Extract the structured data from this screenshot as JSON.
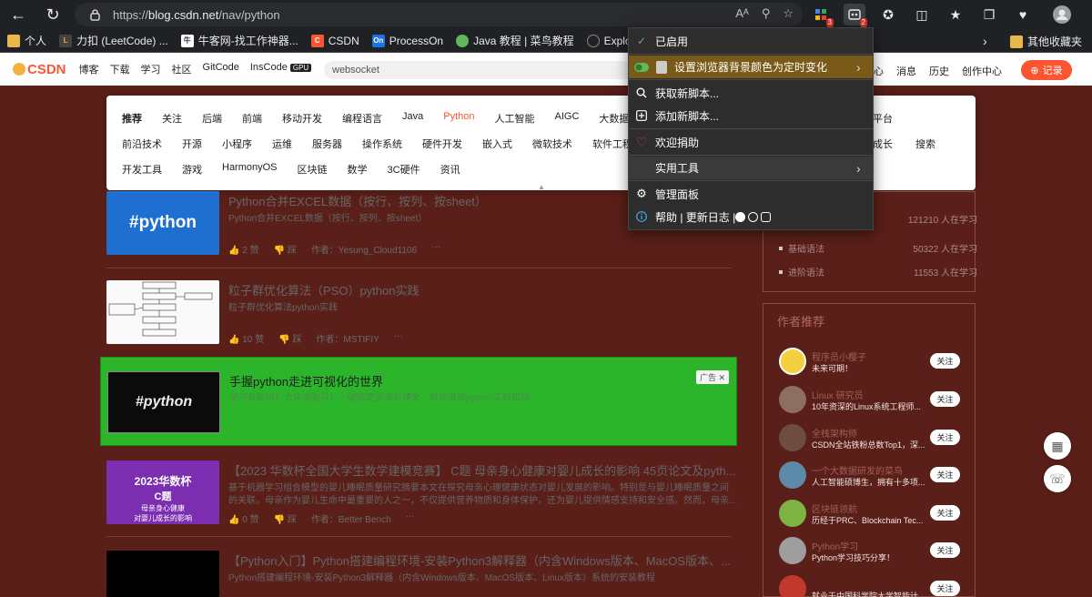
{
  "browser": {
    "url_prefix": "https://",
    "url_host": "blog.csdn.net",
    "url_path": "/nav/python",
    "reader_icon": "Aᴬ",
    "ext_badge_1": "3",
    "ext_badge_2": "2"
  },
  "bookmarks": [
    {
      "label": "个人",
      "icon": "folder-icon",
      "color": "#e8b84a"
    },
    {
      "label": "力扣 (LeetCode) ...",
      "icon": "leetcode-icon",
      "color": "#444444"
    },
    {
      "label": "牛客网-找工作神器...",
      "icon": "nowcoder-icon",
      "color": "#ffffff"
    },
    {
      "label": "CSDN",
      "icon": "csdn-icon",
      "color": "#fc5531"
    },
    {
      "label": "ProcessOn",
      "icon": "processon-icon",
      "color": "#1a73e8"
    },
    {
      "label": "Java 教程 | 菜鸟教程",
      "icon": "runoob-icon",
      "color": "#5fb85a"
    },
    {
      "label": "Explore Git",
      "icon": "github-icon",
      "color": "#222222"
    }
  ],
  "bookmarks_other": "其他收藏夹",
  "header": {
    "logo_text": "CSDN",
    "nav": [
      "博客",
      "下载",
      "学习",
      "社区",
      "GitCode",
      "InsCode"
    ],
    "gpu_badge": "GPU",
    "search_value": "websocket",
    "right_links": [
      "心",
      "消息",
      "历史",
      "创作中心"
    ],
    "record_label": "记录"
  },
  "categories": {
    "row1": [
      "推荐",
      "关注",
      "后端",
      "前端",
      "移动开发",
      "编程语言",
      "Java",
      "Python",
      "人工智能",
      "AIGC",
      "大数据"
    ],
    "row1_tail": "平台",
    "row2": [
      "前沿技术",
      "开源",
      "小程序",
      "运维",
      "服务器",
      "操作系统",
      "硬件开发",
      "嵌入式",
      "微软技术",
      "软件工程"
    ],
    "row2_tail": [
      "成长",
      "搜索"
    ],
    "row3": [
      "开发工具",
      "游戏",
      "HarmonyOS",
      "区块链",
      "数学",
      "3C硬件",
      "资讯"
    ]
  },
  "feed": [
    {
      "title": "Python合并EXCEL数据（按行、按列、按sheet）",
      "desc": "Python合并EXCEL数据（按行、按列、按sheet）",
      "likes": "2 赞",
      "comment": "踩",
      "author": "作者：Yesung_Cloud1106",
      "thumb_text": "#python"
    },
    {
      "title": "粒子群优化算法（PSO）python实践",
      "desc": "粒子群优化算法python实践",
      "likes": "10 赞",
      "comment": "踩",
      "author": "作者：MSTIFIY"
    },
    {
      "title": "【2023 华数杯全国大学生数学建模竞赛】 C题 母亲身心健康对婴儿成长的影响 45页论文及pyth...",
      "desc": "基于机器学习组合模型的婴儿睡眠质量研究摘要本文在探究母亲心理健康状态对婴儿发展的影响。特别是与婴儿睡眠质量之间",
      "desc2": "的关联。母亲作为婴儿生命中最重要的人之一，不仅提供营养物质和身体保护，还为婴儿提供情感支持和安全感。然而，母亲...",
      "likes": "0 赞",
      "comment": "踩",
      "author": "作者：Better Bench",
      "thumb_line1": "2023华数杯",
      "thumb_line2": "C题",
      "thumb_line3": "母亲身心健康",
      "thumb_line4": "对婴儿成长的影响"
    },
    {
      "title": "【Python入门】Python搭建编程环境-安装Python3解释器（内含Windows版本、MacOS版本、...",
      "desc": "Python搭建编程环境-安装Python3解释器（内含Windows版本、MacOS版本、Linux版本）系统的安装教程"
    }
  ],
  "ad": {
    "thumb_text": "#python",
    "title": "手握python走进可视化的世界",
    "desc": "学习有能啦？大佬来指导！一键绑定资源与博文，轻松驾驭python实践知识",
    "tag": "广告 ✕"
  },
  "side_learning": [
    {
      "label": "",
      "count": "121210 人在学习"
    },
    {
      "label": "基础语法",
      "count": "50322 人在学习"
    },
    {
      "label": "进阶语法",
      "count": "11553 人在学习"
    }
  ],
  "authors_title": "作者推荐",
  "authors": [
    {
      "name": "程序员小樱子",
      "desc": "未来可期！",
      "follow": "关注",
      "color": "#f4d03f"
    },
    {
      "name": "Linux 研究员",
      "desc": "10年资深的Linux系统工程师...",
      "follow": "关注",
      "color": "#8d6e63"
    },
    {
      "name": "全栈架构师",
      "desc": "CSDN全站铁粉总数Top1，深...",
      "follow": "关注",
      "color": "#6d4c41"
    },
    {
      "name": "一个大数据研发的菜鸟",
      "desc": "人工智能硕博生，拥有十多项...",
      "follow": "关注",
      "color": "#5d8aa8"
    },
    {
      "name": "区块链领航",
      "desc": "历经于PRC、Blockchain Tec...",
      "follow": "关注",
      "color": "#7cb342"
    },
    {
      "name": "Python学习",
      "desc": "Python学习技巧分享！",
      "follow": "关注",
      "color": "#9e9e9e"
    },
    {
      "name": "",
      "desc": "就业于中国科学院大学智能计",
      "follow": "关注",
      "color": "#c0392b"
    }
  ],
  "popup": {
    "enabled": "已启用",
    "bg_script": "设置浏览器背景颜色为定时变化",
    "get_scripts": "获取新脚本...",
    "add_script": "添加新脚本...",
    "donate": "欢迎捐助",
    "tools": "实用工具",
    "dashboard": "管理面板",
    "help": "帮助 | 更新日志 |"
  },
  "colors": {
    "accent": "#fc5531",
    "page_bg": "#5a1f18",
    "ad_green": "#2cb52a",
    "popup_bg": "#2d2d2d",
    "popup_highlight": "#7a5a18"
  }
}
